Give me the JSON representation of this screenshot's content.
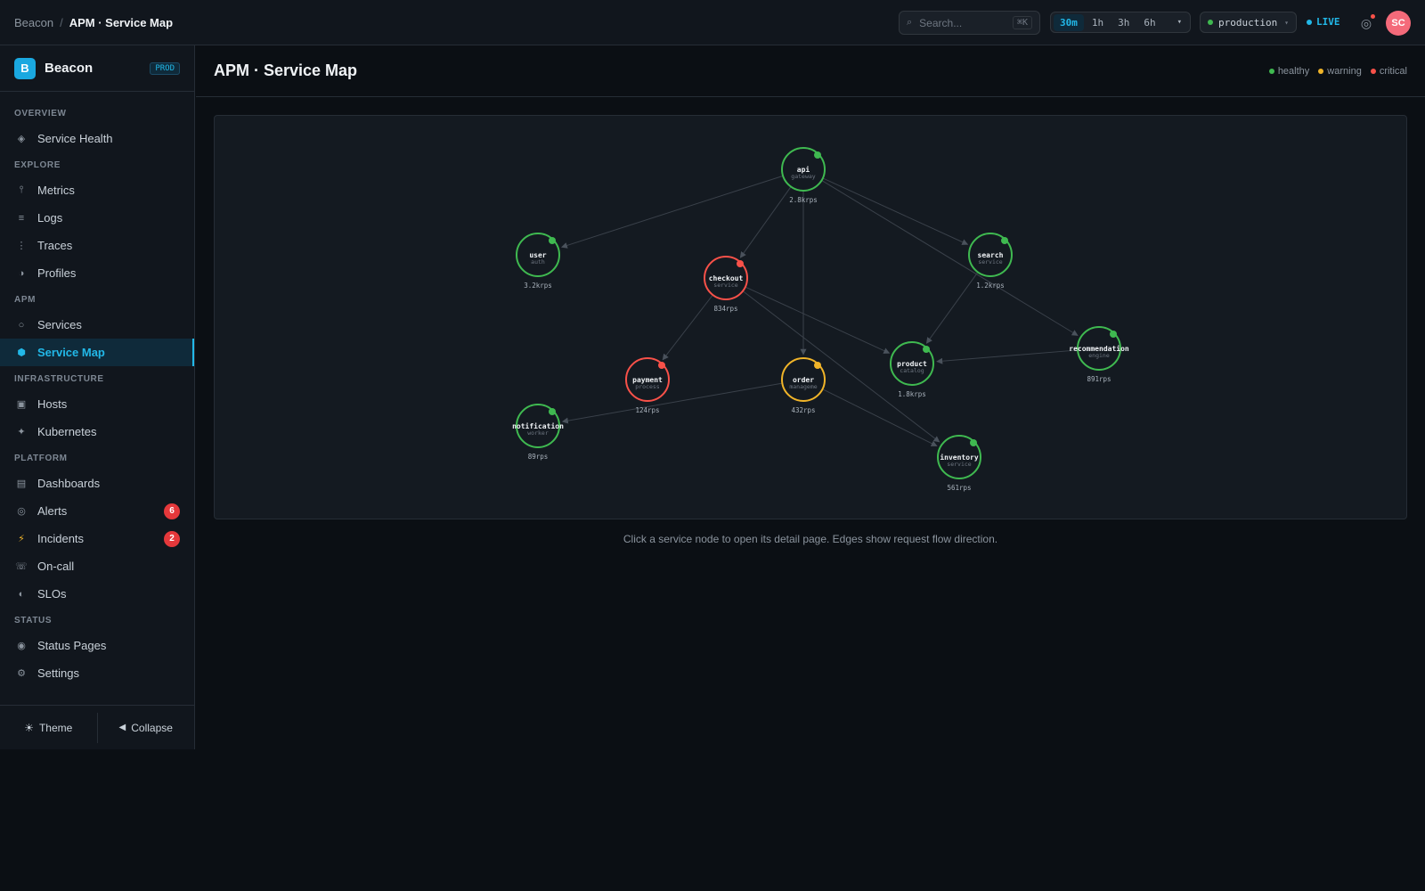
{
  "breadcrumb": {
    "root": "Beacon",
    "separator": "/",
    "current": "APM · Service Map"
  },
  "topbar": {
    "search_placeholder": "Search...",
    "search_shortcut": "⌘K",
    "time_ranges": [
      {
        "label": "30m",
        "active": true
      },
      {
        "label": "1h",
        "active": false
      },
      {
        "label": "3h",
        "active": false
      },
      {
        "label": "6h",
        "active": false
      }
    ],
    "range_caret": "▾",
    "environment": "production",
    "environment_status_color": "#3fb950",
    "live_label": "LIVE",
    "avatar_initials": "SC"
  },
  "sidebar": {
    "brand": "Beacon",
    "logo_letter": "B",
    "env_badge": "PROD",
    "sections": [
      {
        "title": "OVERVIEW",
        "items": [
          {
            "label": "Service Health",
            "icon": "diamond-icon",
            "glyph": "◈"
          }
        ]
      },
      {
        "title": "EXPLORE",
        "items": [
          {
            "label": "Metrics",
            "icon": "metrics-icon",
            "glyph": "⫯"
          },
          {
            "label": "Logs",
            "icon": "logs-icon",
            "glyph": "≡"
          },
          {
            "label": "Traces",
            "icon": "traces-icon",
            "glyph": "⋮"
          },
          {
            "label": "Profiles",
            "icon": "profiles-icon",
            "glyph": "◑"
          }
        ]
      },
      {
        "title": "APM",
        "items": [
          {
            "label": "Services",
            "icon": "services-icon",
            "glyph": "○"
          },
          {
            "label": "Service Map",
            "icon": "service-map-icon",
            "glyph": "⬢",
            "active": true
          }
        ]
      },
      {
        "title": "INFRASTRUCTURE",
        "items": [
          {
            "label": "Hosts",
            "icon": "hosts-icon",
            "glyph": "▣"
          },
          {
            "label": "Kubernetes",
            "icon": "kubernetes-icon",
            "glyph": "✦"
          }
        ]
      },
      {
        "title": "PLATFORM",
        "items": [
          {
            "label": "Dashboards",
            "icon": "dashboards-icon",
            "glyph": "▤"
          },
          {
            "label": "Alerts",
            "icon": "alerts-icon",
            "glyph": "◎",
            "badge": "6"
          },
          {
            "label": "Incidents",
            "icon": "incidents-icon",
            "glyph": "⚡",
            "badge": "2"
          },
          {
            "label": "On-call",
            "icon": "on-call-icon",
            "glyph": "☏"
          },
          {
            "label": "SLOs",
            "icon": "slos-icon",
            "glyph": "◐"
          }
        ]
      },
      {
        "title": "STATUS",
        "items": [
          {
            "label": "Status Pages",
            "icon": "status-pages-icon",
            "glyph": "◉"
          },
          {
            "label": "Settings",
            "icon": "settings-icon",
            "glyph": "⚙"
          }
        ]
      }
    ],
    "footer": {
      "theme_label": "Theme",
      "theme_glyph": "☀",
      "collapse_label": "Collapse",
      "collapse_glyph": "◀"
    }
  },
  "page": {
    "title": "APM · Service Map",
    "legend": [
      {
        "label": "healthy",
        "color": "#3fb950"
      },
      {
        "label": "warning",
        "color": "#f0b429"
      },
      {
        "label": "critical",
        "color": "#f85149"
      }
    ],
    "hint": "Click a service node to open its detail page. Edges show request flow direction."
  },
  "colors": {
    "healthy": "#3fb950",
    "warning": "#f0b429",
    "critical": "#f85149",
    "accent": "#22b8e8"
  },
  "service_map": {
    "nodes": [
      {
        "id": "api",
        "name": "api",
        "kind": "gateway",
        "rps": "2.8krps",
        "status": "healthy"
      },
      {
        "id": "user",
        "name": "user",
        "kind": "auth",
        "rps": "3.2krps",
        "status": "healthy"
      },
      {
        "id": "checkout",
        "name": "checkout",
        "kind": "service",
        "rps": "834rps",
        "status": "critical"
      },
      {
        "id": "search",
        "name": "search",
        "kind": "service",
        "rps": "1.2krps",
        "status": "healthy"
      },
      {
        "id": "recommendation",
        "name": "recommendation",
        "kind": "engine",
        "rps": "891rps",
        "status": "healthy"
      },
      {
        "id": "product",
        "name": "product",
        "kind": "catalog",
        "rps": "1.8krps",
        "status": "healthy"
      },
      {
        "id": "payment",
        "name": "payment",
        "kind": "process",
        "rps": "124rps",
        "status": "critical"
      },
      {
        "id": "order",
        "name": "order",
        "kind": "manageme",
        "rps": "432rps",
        "status": "warning"
      },
      {
        "id": "notification",
        "name": "notification",
        "kind": "worker",
        "rps": "89rps",
        "status": "healthy"
      },
      {
        "id": "inventory",
        "name": "inventory",
        "kind": "service",
        "rps": "561rps",
        "status": "healthy"
      }
    ],
    "edges": [
      [
        "api",
        "user"
      ],
      [
        "api",
        "checkout"
      ],
      [
        "api",
        "search"
      ],
      [
        "api",
        "order"
      ],
      [
        "api",
        "recommendation"
      ],
      [
        "checkout",
        "payment"
      ],
      [
        "checkout",
        "product"
      ],
      [
        "checkout",
        "inventory"
      ],
      [
        "search",
        "product"
      ],
      [
        "recommendation",
        "product"
      ],
      [
        "order",
        "notification"
      ],
      [
        "order",
        "inventory"
      ]
    ]
  }
}
